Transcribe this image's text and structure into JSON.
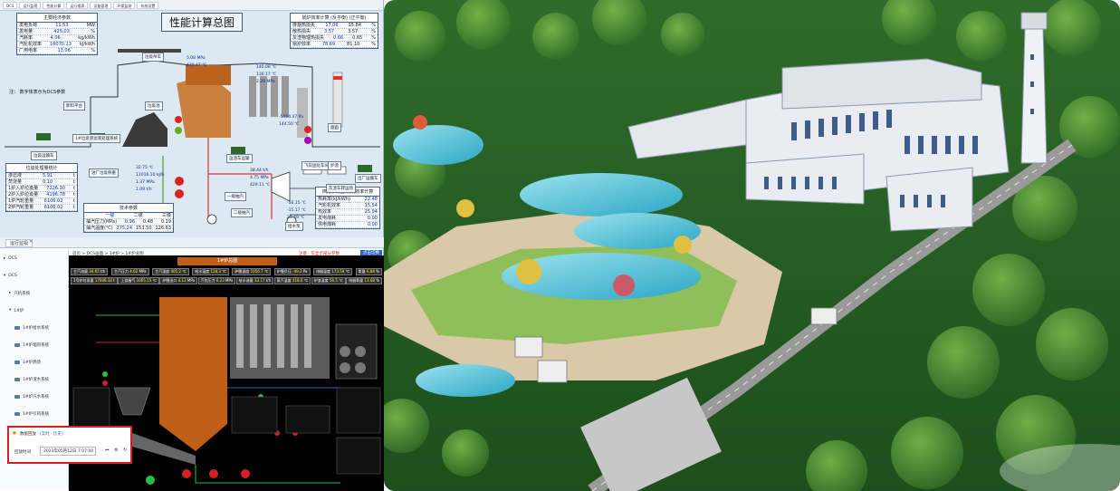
{
  "perf_panel": {
    "tabs": [
      "DCS",
      "运行监视",
      "性能计算",
      "运行报表",
      "设备管理",
      "环保监测",
      "系统设置"
    ],
    "title": "性能计算总图",
    "main_params": {
      "header": "主要经济参数",
      "rows": [
        {
          "name": "发电负荷",
          "value": "11.53",
          "unit": "MW"
        },
        {
          "name": "发电量",
          "value": "425.03",
          "unit": "%"
        },
        {
          "name": "汽耗率",
          "value": "4.06",
          "unit": "kg/kWh"
        },
        {
          "name": "汽轮机效率",
          "value": "16070.13",
          "unit": "kJ/kWh"
        },
        {
          "name": "厂用电率",
          "value": "13.06",
          "unit": "%"
        }
      ]
    },
    "boiler_eff": {
      "header": "锅炉效率计算",
      "col1": "(反平衡)",
      "col2": "(正平衡)",
      "rows": [
        {
          "name": "排烟热损失",
          "v1": "17.06",
          "v2": "15.84",
          "unit": "%"
        },
        {
          "name": "散热损失",
          "v1": "3.57",
          "v2": "3.57",
          "unit": "%"
        },
        {
          "name": "灰渣物理热损失",
          "v1": "0.66",
          "v2": "0.65",
          "unit": "%"
        },
        {
          "name": "锅炉效率",
          "v1": "78.69",
          "v2": "81.10",
          "unit": "%"
        }
      ]
    },
    "note": "注：  数字体表示为DCS参数",
    "waste_stats": {
      "header": "垃圾处理量统计",
      "rows": [
        {
          "name": "渗滤液",
          "value": "5.91",
          "unit": "t"
        },
        {
          "name": "焚烧量",
          "value": "0.10",
          "unit": "t"
        },
        {
          "name": "1炉入炉垃圾量",
          "value": "7226.30",
          "unit": "t"
        },
        {
          "name": "2炉入炉垃圾量",
          "value": "4196.78",
          "unit": "t"
        },
        {
          "name": "1炉汽轮重量",
          "value": "6106.02",
          "unit": "t"
        },
        {
          "name": "2炉汽轮重量",
          "value": "6106.02",
          "unit": "t"
        }
      ]
    },
    "param_box": {
      "header": "技术参数",
      "cols": [
        "",
        "一级",
        "二级",
        "三级"
      ],
      "rows": [
        {
          "name": "抽汽压力(MPa)",
          "v": [
            "0.96",
            "0.48",
            "0.19"
          ]
        },
        {
          "name": "抽汽温度(℃)",
          "v": [
            "275.24",
            "153.50",
            "126.63"
          ]
        }
      ]
    },
    "right_box": {
      "header": "热力系统图  辅机效率计算",
      "rows": [
        {
          "name": "热耗率(kJ/kWh)",
          "value": "22.48"
        },
        {
          "name": "汽轮机效率",
          "value": "15.54"
        },
        {
          "name": "热效率",
          "value": "25.94"
        },
        {
          "name": "发电煤耗",
          "value": "0.00"
        },
        {
          "name": "供电煤耗",
          "value": "0.00"
        }
      ]
    },
    "labels": {
      "crane": "垃圾吊车",
      "unload": "卸料平台",
      "pit": "垃圾池",
      "truck": "垃圾运输车",
      "leachate": "1#垃圾渗滤液处理系统",
      "scale": "进厂垃圾称重",
      "fly_ash": "飞灰固化车间",
      "slag_box": "炉渣",
      "slag_truck": "出厂运输车",
      "residue": "灰渣车转运场",
      "transport": "运渣车运输",
      "condenser": "二级抽汽",
      "level1": "一级抽汽",
      "chimney": "烟囱",
      "pump": "给水泵"
    },
    "values": {
      "v1": "140.08 ℃",
      "v2": "130.17 ℃",
      "v3": "2.28 MPa",
      "v4": "-5084.47 Pa",
      "v5": "144.50 ℃",
      "v6": "32.75 ℃",
      "v7": "11016.10 kJ/h",
      "v8": "1.37 MPa",
      "v9": "1.09 t/h",
      "v10": "5.08 MPa",
      "v11": "430.47 ℃",
      "v12": "4.75 MPa",
      "v13": "429.11 ℃",
      "v14": "38.44 t/h",
      "v15": "-56.15 ℃",
      "v16": "-15.17 ℃",
      "v17": "25.49 ℃"
    }
  },
  "dcs_panel": {
    "header_tab": "运行监视",
    "tree": [
      "DCS",
      "DCS",
      "汽机系统",
      "1#炉",
      "1#炉给水系统",
      "1#炉烟风系统",
      "1#炉燃烧",
      "1#炉渣水系统",
      "1#炉汽水系统",
      "1#炉引风系统",
      "1#炉烟气系统"
    ],
    "breadcrumb": "首页 > DCS画面 > 1#炉 > 1#炉总图",
    "screen_title": "1#炉总图",
    "top_right_hint": "注意：仅显示部分参数",
    "button": "点击切换",
    "popup": {
      "title": "数据回放",
      "mode": "(实时 · 历史)",
      "label": "回放时间",
      "value": "2023年05月12日 7:07:00"
    },
    "metrics": [
      {
        "n": "主汽流量",
        "v": "34.65",
        "u": "t/h"
      },
      {
        "n": "主汽压力",
        "v": "4.62",
        "u": "MPa"
      },
      {
        "n": "主汽温度",
        "v": "405.2",
        "u": "℃"
      },
      {
        "n": "给水温度",
        "v": "128.3",
        "u": "℃"
      },
      {
        "n": "炉膛温度",
        "v": "1056.7",
        "u": "℃"
      },
      {
        "n": "炉膛负压",
        "v": "-49.2",
        "u": "Pa"
      },
      {
        "n": "排烟温度",
        "v": "173.59",
        "u": "℃"
      },
      {
        "n": "氧量",
        "v": "6.88",
        "u": "%"
      }
    ],
    "metrics2": [
      {
        "n": "1号炉垃圾量",
        "v": "17008.34",
        "u": "t"
      },
      {
        "n": "上游烟气",
        "v": "1065.15",
        "u": "℃"
      },
      {
        "n": "炉膛出口",
        "v": "4.12",
        "u": "MPa"
      },
      {
        "n": "汽包压力",
        "v": "6.23",
        "u": "MPa"
      },
      {
        "n": "给水流量",
        "v": "33.17",
        "u": "t/h"
      },
      {
        "n": "蒸汽温度",
        "v": "418.6",
        "u": "℃"
      },
      {
        "n": "炉渣温度",
        "v": "56.5",
        "u": "℃"
      },
      {
        "n": "排烟氧量",
        "v": "13.08",
        "u": "%"
      }
    ]
  },
  "colors": {
    "dcs_red": "#d42020",
    "dcs_green": "#22c040",
    "dcs_orange": "#c06018",
    "accent_blue": "#1030c0"
  }
}
